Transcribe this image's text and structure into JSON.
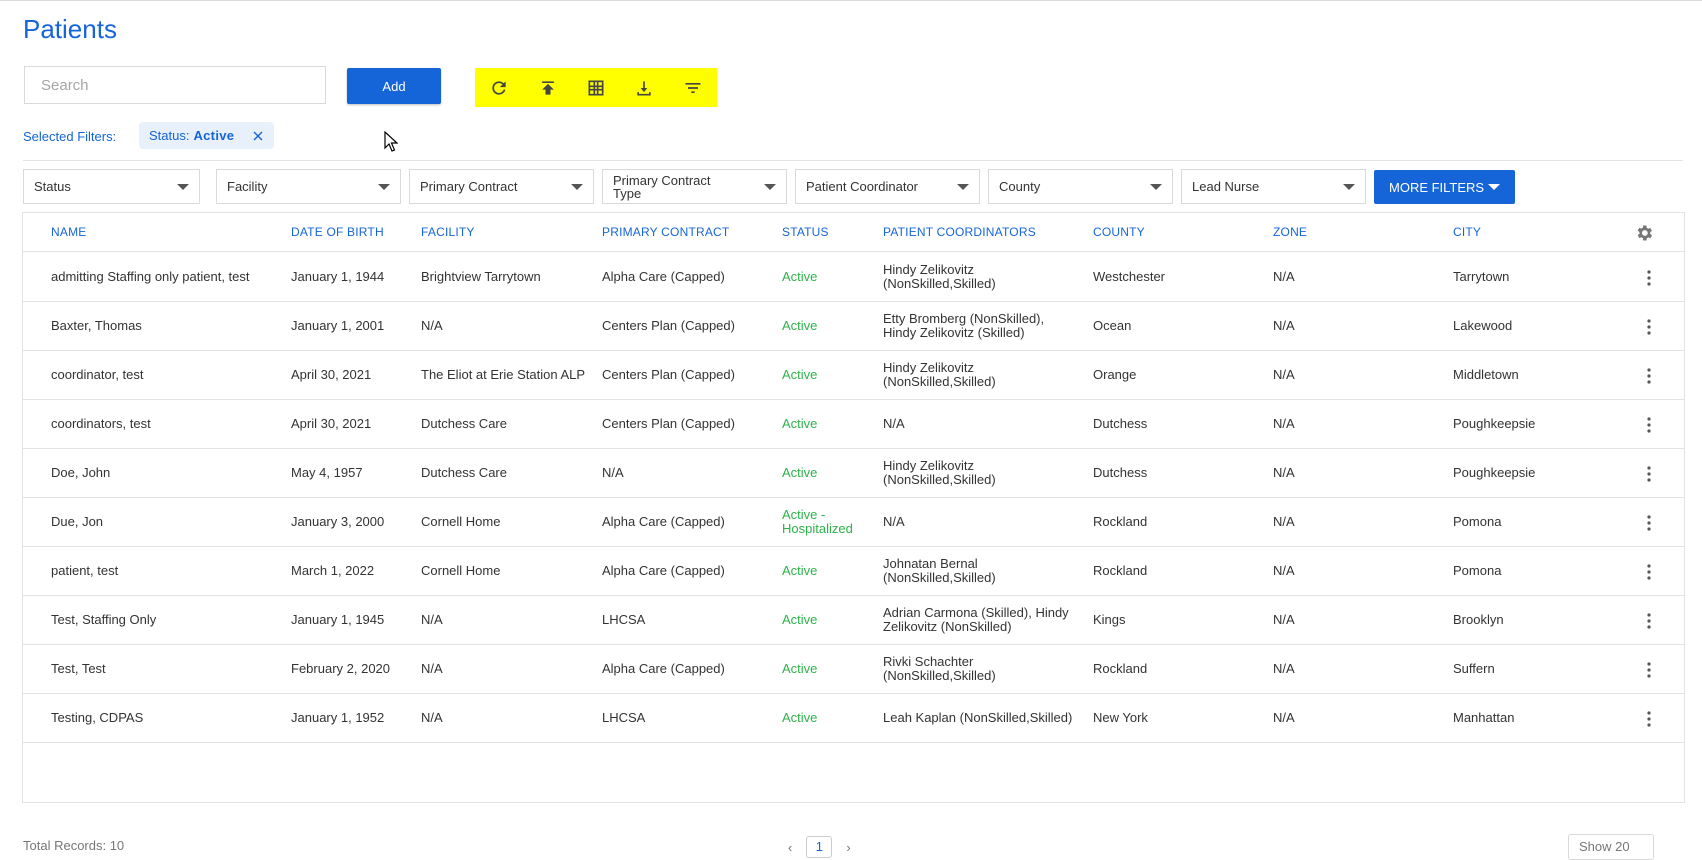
{
  "page": {
    "title": "Patients"
  },
  "search": {
    "placeholder": "Search"
  },
  "toolbar": {
    "add_label": "Add",
    "highlight_color": "#ffff00",
    "icons": [
      "refresh-icon",
      "upload-icon",
      "grid-icon",
      "download-icon",
      "filter-list-icon"
    ]
  },
  "selected_filters": {
    "label": "Selected Filters:",
    "chips": [
      {
        "key": "Status:",
        "value": "Active"
      }
    ]
  },
  "filters": {
    "status": "Status",
    "facility": "Facility",
    "primary_contract": "Primary Contract",
    "primary_contract_type_1": "Primary Contract",
    "primary_contract_type_2": "Type",
    "patient_coordinator": "Patient Coordinator",
    "county": "County",
    "lead_nurse": "Lead Nurse",
    "more_filters": "MORE FILTERS"
  },
  "table": {
    "columns": [
      "NAME",
      "DATE OF BIRTH",
      "FACILITY",
      "PRIMARY CONTRACT",
      "STATUS",
      "PATIENT COORDINATORS",
      "COUNTY",
      "ZONE",
      "CITY"
    ],
    "rows": [
      {
        "name": "admitting Staffing only patient, test",
        "dob": "January 1, 1944",
        "facility": "Brightview Tarrytown",
        "contract": "Alpha Care (Capped)",
        "status1": "Active",
        "status2": "",
        "coord1": "Hindy Zelikovitz",
        "coord2": "(NonSkilled,Skilled)",
        "county": "Westchester",
        "zone": "N/A",
        "city": "Tarrytown"
      },
      {
        "name": "Baxter, Thomas",
        "dob": "January 1, 2001",
        "facility": "N/A",
        "contract": "Centers Plan (Capped)",
        "status1": "Active",
        "status2": "",
        "coord1": "Etty Bromberg (NonSkilled),",
        "coord2": "Hindy Zelikovitz (Skilled)",
        "county": "Ocean",
        "zone": "N/A",
        "city": "Lakewood"
      },
      {
        "name": "coordinator, test",
        "dob": "April 30, 2021",
        "facility": "The Eliot at Erie Station ALP",
        "contract": "Centers Plan (Capped)",
        "status1": "Active",
        "status2": "",
        "coord1": "Hindy Zelikovitz",
        "coord2": "(NonSkilled,Skilled)",
        "county": "Orange",
        "zone": "N/A",
        "city": "Middletown"
      },
      {
        "name": "coordinators, test",
        "dob": "April 30, 2021",
        "facility": "Dutchess Care",
        "contract": "Centers Plan (Capped)",
        "status1": "Active",
        "status2": "",
        "coord1": "N/A",
        "coord2": "",
        "county": "Dutchess",
        "zone": "N/A",
        "city": "Poughkeepsie"
      },
      {
        "name": "Doe, John",
        "dob": "May 4, 1957",
        "facility": "Dutchess Care",
        "contract": "N/A",
        "status1": "Active",
        "status2": "",
        "coord1": "Hindy Zelikovitz",
        "coord2": "(NonSkilled,Skilled)",
        "county": "Dutchess",
        "zone": "N/A",
        "city": "Poughkeepsie"
      },
      {
        "name": "Due, Jon",
        "dob": "January 3, 2000",
        "facility": "Cornell Home",
        "contract": "Alpha Care (Capped)",
        "status1": "Active -",
        "status2": "Hospitalized",
        "coord1": "N/A",
        "coord2": "",
        "county": "Rockland",
        "zone": "N/A",
        "city": "Pomona"
      },
      {
        "name": "patient, test",
        "dob": "March 1, 2022",
        "facility": "Cornell Home",
        "contract": "Alpha Care (Capped)",
        "status1": "Active",
        "status2": "",
        "coord1": "Johnatan Bernal",
        "coord2": "(NonSkilled,Skilled)",
        "county": "Rockland",
        "zone": "N/A",
        "city": "Pomona"
      },
      {
        "name": "Test, Staffing Only",
        "dob": "January 1, 1945",
        "facility": "N/A",
        "contract": "LHCSA",
        "status1": "Active",
        "status2": "",
        "coord1": "Adrian Carmona (Skilled), Hindy",
        "coord2": "Zelikovitz (NonSkilled)",
        "county": "Kings",
        "zone": "N/A",
        "city": "Brooklyn"
      },
      {
        "name": "Test, Test",
        "dob": "February 2, 2020",
        "facility": "N/A",
        "contract": "Alpha Care (Capped)",
        "status1": "Active",
        "status2": "",
        "coord1": "Rivki Schachter",
        "coord2": "(NonSkilled,Skilled)",
        "county": "Rockland",
        "zone": "N/A",
        "city": "Suffern"
      },
      {
        "name": "Testing, CDPAS",
        "dob": "January 1, 1952",
        "facility": "N/A",
        "contract": "LHCSA",
        "status1": "Active",
        "status2": "",
        "coord1": "Leah Kaplan (NonSkilled,Skilled)",
        "coord2": "",
        "county": "New York",
        "zone": "N/A",
        "city": "Manhattan"
      }
    ]
  },
  "footer": {
    "total_records": "Total Records: 10",
    "page": "1",
    "show": "Show 20"
  },
  "colors": {
    "accent": "#1565d8",
    "status_active": "#2db34a"
  }
}
